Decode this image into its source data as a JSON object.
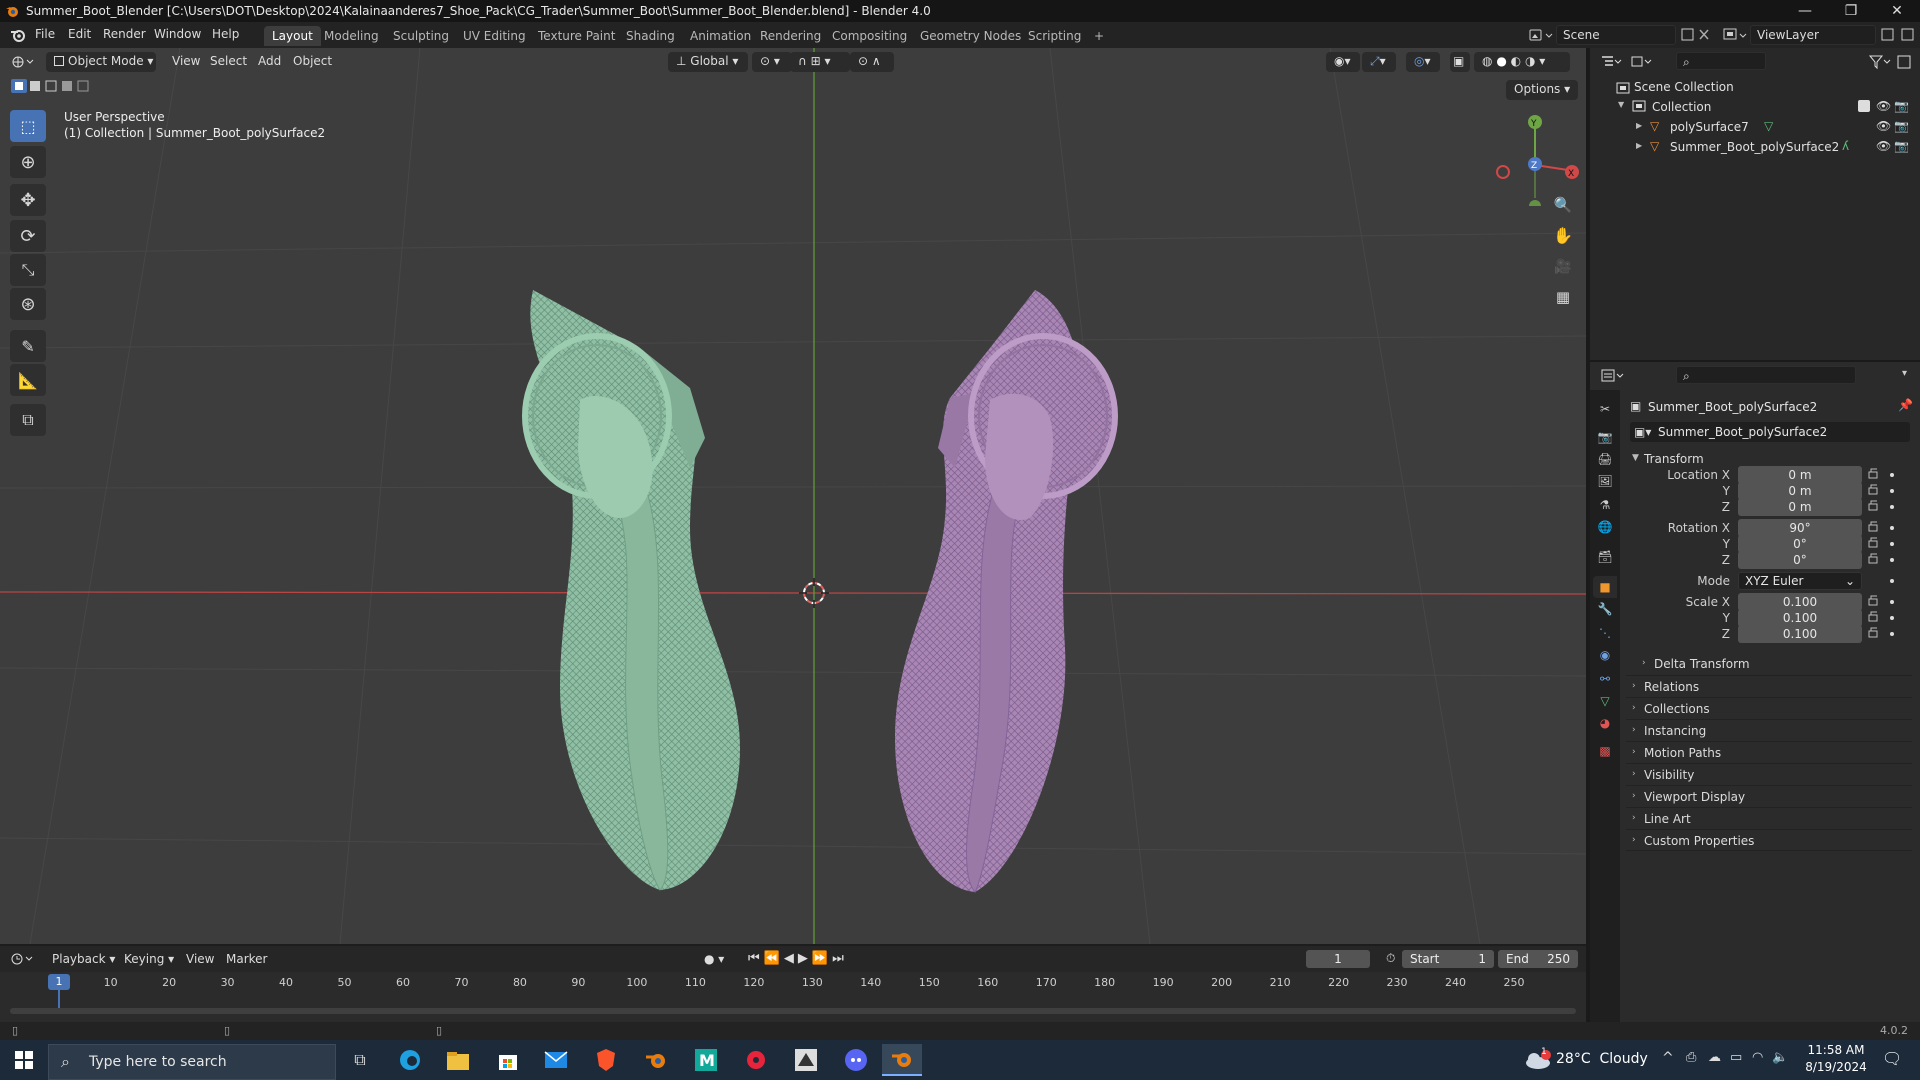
{
  "window": {
    "title": "Summer_Boot_Blender [C:\\Users\\DOT\\Desktop\\2024\\Kalainaanderes7_Shoe_Pack\\CG_Trader\\Summer_Boot\\Summer_Boot_Blender.blend] - Blender 4.0"
  },
  "menus": [
    "File",
    "Edit",
    "Render",
    "Window",
    "Help"
  ],
  "workspaces": [
    "Layout",
    "Modeling",
    "Sculpting",
    "UV Editing",
    "Texture Paint",
    "Shading",
    "Animation",
    "Rendering",
    "Compositing",
    "Geometry Nodes",
    "Scripting"
  ],
  "workspace_add": "+",
  "scene": {
    "scene_name": "Scene",
    "view_layer": "ViewLayer"
  },
  "viewport": {
    "mode": "Object Mode",
    "menus": [
      "View",
      "Select",
      "Add",
      "Object"
    ],
    "orientation": "Global",
    "options_label": "Options",
    "perspective_label": "User Perspective",
    "collection_label": "(1) Collection | Summer_Boot_polySurface2",
    "gizmo": {
      "x": "X",
      "y": "Y",
      "z": "Z"
    }
  },
  "outliner": {
    "scene_collection": "Scene Collection",
    "collection": "Collection",
    "objects": [
      "polySurface7",
      "Summer_Boot_polySurface2"
    ]
  },
  "properties": {
    "object_name": "Summer_Boot_polySurface2",
    "data_name": "Summer_Boot_polySurface2",
    "transform_title": "Transform",
    "location_label": "Location X",
    "location": [
      "0 m",
      "0 m",
      "0 m"
    ],
    "rotation_label": "Rotation X",
    "rotation": [
      "90°",
      "0°",
      "0°"
    ],
    "axis_y": "Y",
    "axis_z": "Z",
    "mode_label": "Mode",
    "mode_value": "XYZ Euler",
    "scale_label": "Scale X",
    "scale": [
      "0.100",
      "0.100",
      "0.100"
    ],
    "delta_transform": "Delta Transform",
    "panels": [
      "Relations",
      "Collections",
      "Instancing",
      "Motion Paths",
      "Visibility",
      "Viewport Display",
      "Line Art",
      "Custom Properties"
    ]
  },
  "timeline": {
    "menus": [
      "Playback",
      "Keying",
      "View",
      "Marker"
    ],
    "current_frame": "1",
    "start_label": "Start",
    "start": "1",
    "end_label": "End",
    "end": "250",
    "ticks": [
      "1",
      "10",
      "20",
      "30",
      "40",
      "50",
      "60",
      "70",
      "80",
      "90",
      "100",
      "110",
      "120",
      "130",
      "140",
      "150",
      "160",
      "170",
      "180",
      "190",
      "200",
      "210",
      "220",
      "230",
      "240",
      "250"
    ]
  },
  "status": {
    "version": "4.0.2"
  },
  "taskbar": {
    "search_placeholder": "Type here to search",
    "weather": "28°C  Cloudy",
    "weather_badge": "1",
    "time": "11:58 AM",
    "date": "8/19/2024"
  },
  "colors": {
    "left_boot": "#8fbfa4",
    "right_boot": "#a986b4",
    "axis_x": "#d04848",
    "axis_y": "#6ea646",
    "accent": "#4772b3"
  }
}
